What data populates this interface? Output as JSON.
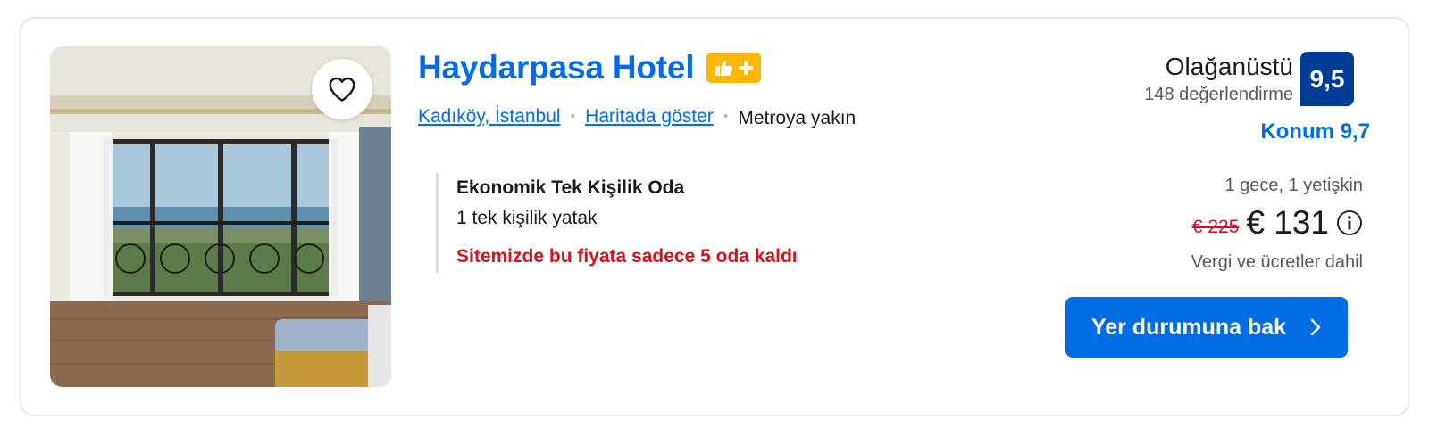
{
  "hotel": {
    "name": "Haydarpasa Hotel",
    "badge_icon": "thumbs-up-plus-icon",
    "location": "Kadıköy, İstanbul",
    "map_link": "Haritada göster",
    "proximity": "Metroya yakın",
    "photo_alt": "hotel room with balcony and sea view"
  },
  "room": {
    "name": "Ekonomik Tek Kişilik Oda",
    "bed": "1 tek kişilik yatak",
    "availability_warning": "Sitemizde bu fiyata sadece 5 oda kaldı"
  },
  "rating": {
    "label": "Olağanüstü",
    "reviews": "148 değerlendirme",
    "score": "9,5",
    "location_score": "Konum 9,7"
  },
  "pricing": {
    "stay": "1 gece, 1 yetişkin",
    "old_price": "€ 225",
    "new_price": "€ 131",
    "taxes": "Vergi ve ücretler dahil"
  },
  "cta": {
    "label": "Yer durumuna bak"
  },
  "colors": {
    "brand_blue": "#006ce4",
    "score_blue": "#003b95",
    "badge_yellow": "#ffb700",
    "warning_red": "#d4111e"
  }
}
